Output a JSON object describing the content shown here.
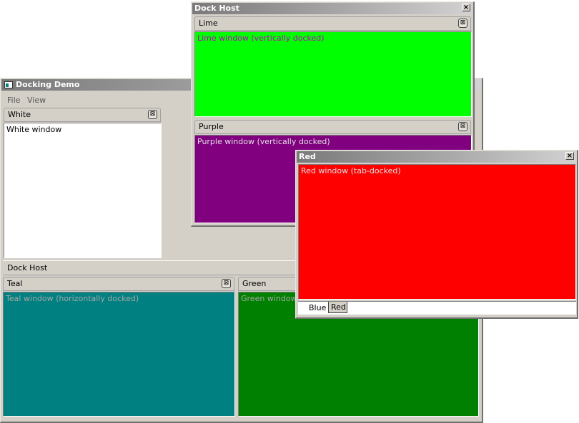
{
  "main_window": {
    "title": "Docking Demo",
    "menu": [
      "File",
      "View"
    ],
    "white_dock": {
      "title": "White",
      "content": "White window",
      "bg": "#ffffff",
      "fg": "#000000"
    },
    "bottom_host_label": "Dock Host",
    "teal_dock": {
      "title": "Teal",
      "content": "Teal window (horizontally docked)",
      "bg": "#008080",
      "fg": "#a6a6a6"
    },
    "green_dock": {
      "title": "Green",
      "content": "Green window (horizontally docked)",
      "bg": "#008000",
      "fg": "#a6a6a6"
    }
  },
  "dock_host_window": {
    "title": "Dock Host",
    "close": "×",
    "lime_dock": {
      "title": "Lime",
      "content": "Lime window (vertically docked)",
      "bg": "#00ff00",
      "fg": "#c000c0"
    },
    "purple_dock": {
      "title": "Purple",
      "content": "Purple window (vertically docked)",
      "bg": "#800080",
      "fg": "#e0e0e0"
    }
  },
  "red_window": {
    "title": "Red",
    "close": "×",
    "content": "Red window (tab-docked)",
    "bg": "#ff0000",
    "fg": "#e0e0e0",
    "tabs": [
      "Blue",
      "Red"
    ],
    "active_tab": "Red"
  },
  "dock_close_glyph": "⊠"
}
